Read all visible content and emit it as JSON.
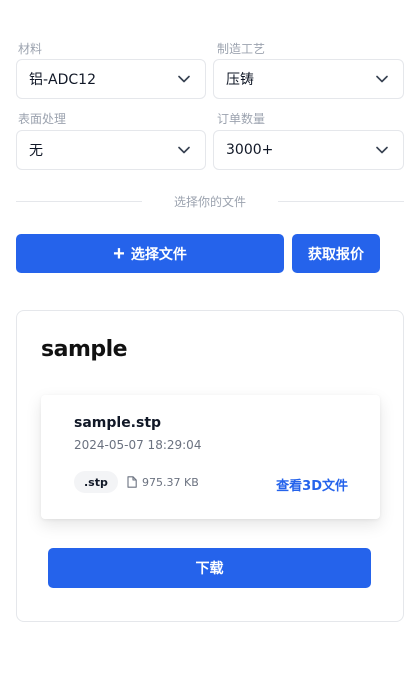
{
  "form": {
    "material": {
      "label": "材料",
      "value": "铝-ADC12"
    },
    "process": {
      "label": "制造工艺",
      "value": "压铸"
    },
    "surface": {
      "label": "表面处理",
      "value": "无"
    },
    "quantity": {
      "label": "订单数量",
      "value": "3000+"
    }
  },
  "upload": {
    "divider_text": "选择你的文件",
    "choose_button": "选择文件",
    "quote_button": "获取报价"
  },
  "result": {
    "title": "sample",
    "file": {
      "name": "sample.stp",
      "date": "2024-05-07 18:29:04",
      "extension": ".stp",
      "size": "975.37 KB",
      "view_link": "查看3D文件"
    },
    "download_button": "下载"
  },
  "icons": {
    "chevron": "chevron-down-icon",
    "plus": "plus-icon",
    "file": "file-icon"
  },
  "colors": {
    "primary": "#2563eb",
    "border": "#e5e7eb",
    "muted": "#9ca3af"
  }
}
